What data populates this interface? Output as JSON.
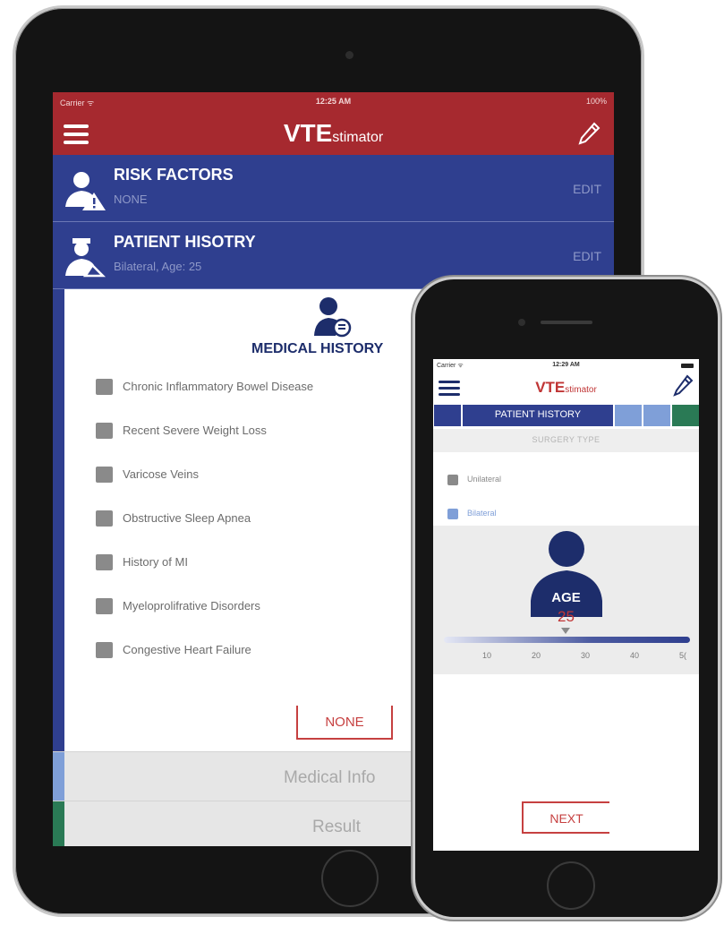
{
  "ipad": {
    "statusbar": {
      "carrier": "Carrier ᯤ",
      "time": "12:25 AM",
      "battery": "100%"
    },
    "app_title_big": "VTE",
    "app_title_small": "stimator",
    "rows": [
      {
        "title": "RISK FACTORS",
        "subtitle": "NONE",
        "action": "EDIT",
        "icon": "person-warning-icon"
      },
      {
        "title": "PATIENT HISOTRY",
        "subtitle": "Bilateral, Age: 25",
        "action": "EDIT",
        "icon": "doctor-icon"
      }
    ],
    "medical_history": {
      "title": "MEDICAL HISTORY",
      "items": [
        "Chronic Inflammatory Bowel Disease",
        "Recent Severe Weight Loss",
        "Varicose Veins",
        "Obstructive Sleep Apnea",
        "History of MI",
        "Myeloprolifrative Disorders",
        "Congestive Heart Failure"
      ],
      "none_label": "NONE"
    },
    "tabs": [
      {
        "label": "Medical Info",
        "color": "#7f9fd8"
      },
      {
        "label": "Result",
        "color": "#2a7a55"
      }
    ]
  },
  "iphone": {
    "statusbar": {
      "carrier": "Carrier ᯤ",
      "time": "12:29 AM"
    },
    "app_title_big": "VTE",
    "app_title_small": "stimator",
    "step_label": "PATIENT HISTORY",
    "section_title": "SURGERY TYPE",
    "options": [
      {
        "label": "Unilateral",
        "selected": false
      },
      {
        "label": "Bilateral",
        "selected": true
      }
    ],
    "age": {
      "label": "AGE",
      "value": "25",
      "ticks": [
        "10",
        "20",
        "30",
        "40",
        "5("
      ]
    },
    "next_label": "NEXT"
  },
  "colors": {
    "header_red": "#a6292f",
    "navy": "#2f3f8f",
    "accent_red": "#c64040",
    "light_blue": "#7f9fd8",
    "green": "#2a7a55"
  }
}
